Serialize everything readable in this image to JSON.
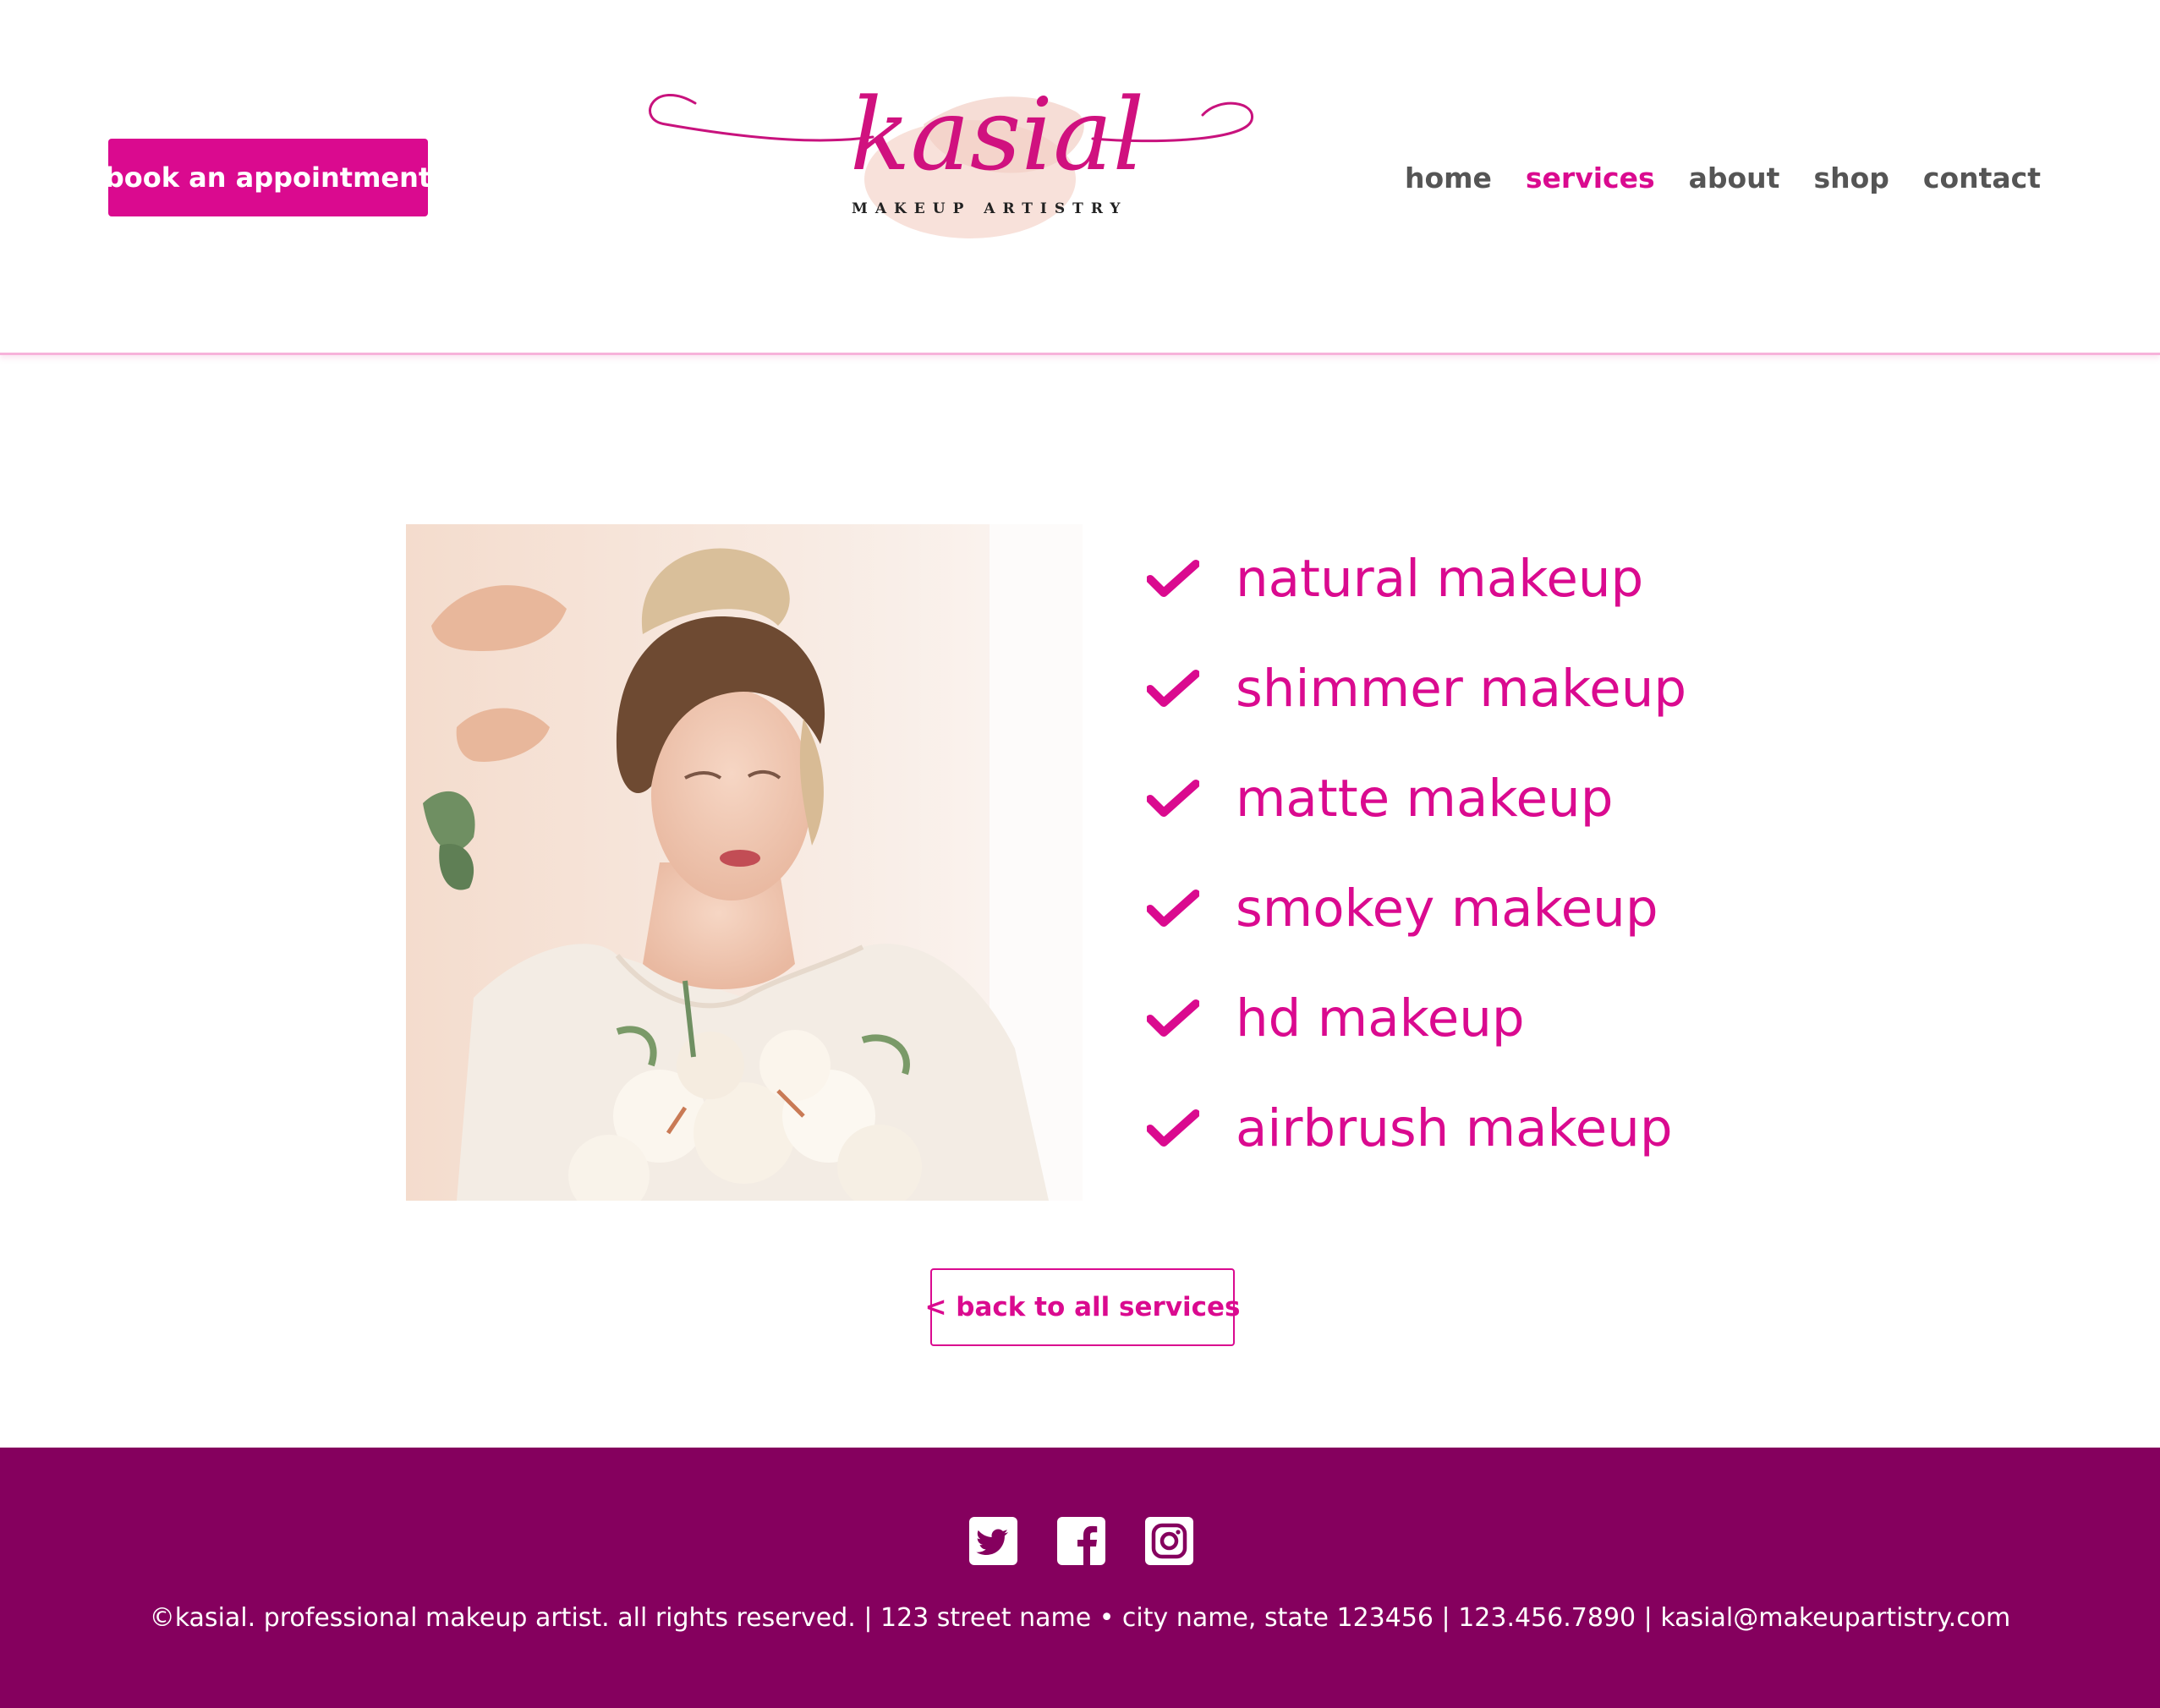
{
  "header": {
    "cta_label": "book an appointment",
    "logo": {
      "name": "kasial",
      "tagline": "MAKEUP ARTISTRY"
    },
    "nav": [
      {
        "label": "home",
        "active": false
      },
      {
        "label": "services",
        "active": true
      },
      {
        "label": "about",
        "active": false
      },
      {
        "label": "shop",
        "active": false
      },
      {
        "label": "contact",
        "active": false
      }
    ]
  },
  "main": {
    "services": [
      {
        "label": "natural makeup",
        "icon": "check-icon"
      },
      {
        "label": "shimmer makeup",
        "icon": "check-icon"
      },
      {
        "label": "matte makeup",
        "icon": "check-icon"
      },
      {
        "label": "smokey makeup",
        "icon": "check-icon"
      },
      {
        "label": "hd makeup",
        "icon": "check-icon"
      },
      {
        "label": "airbrush makeup",
        "icon": "check-icon"
      }
    ],
    "back_label": "< back to all services"
  },
  "footer": {
    "social": [
      "twitter-icon",
      "facebook-icon",
      "instagram-icon"
    ],
    "text": "©kasial. professional makeup artist. all rights reserved. | 123 street name • city name, state 123456 | 123.456.7890 | kasial@makeupartistry.com"
  },
  "colors": {
    "accent": "#da0a8f",
    "footer_bg": "#85005e",
    "nav_text": "#555555",
    "header_border": "#f7b2da"
  }
}
